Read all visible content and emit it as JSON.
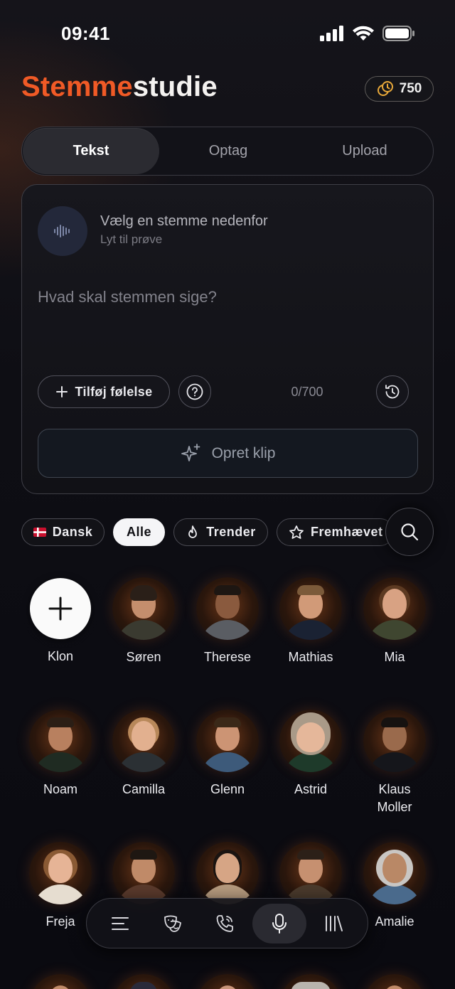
{
  "status_bar": {
    "time": "09:41",
    "icons": [
      "cellular-icon",
      "wifi-icon",
      "battery-icon"
    ]
  },
  "header": {
    "title_accent": "Stemme",
    "title_rest": "studie",
    "credits": "750",
    "credits_icon": "coins-icon",
    "accent_color": "#f05a26"
  },
  "tabs": [
    {
      "label": "Tekst",
      "active": true
    },
    {
      "label": "Optag",
      "active": false
    },
    {
      "label": "Upload",
      "active": false
    }
  ],
  "composer": {
    "voice_title": "Vælg en stemme nedenfor",
    "voice_subtitle": "Lyt til prøve",
    "placeholder": "Hvad skal stemmen sige?",
    "value": "",
    "emotion_label": "Tilføj følelse",
    "char_count": "0/700",
    "create_label": "Opret klip"
  },
  "filters": {
    "language": "Dansk",
    "chips": [
      {
        "label": "Alle",
        "active": true
      },
      {
        "label": "Trender",
        "icon": "flame-icon"
      },
      {
        "label": "Fremhævet",
        "icon": "star-icon"
      }
    ]
  },
  "voices": [
    {
      "name": "Klon",
      "type": "clone"
    },
    {
      "name": "Søren"
    },
    {
      "name": "Therese"
    },
    {
      "name": "Mathias"
    },
    {
      "name": "Mia"
    },
    {
      "name": "Noam"
    },
    {
      "name": "Camilla"
    },
    {
      "name": "Glenn"
    },
    {
      "name": "Astrid"
    },
    {
      "name": "Klaus\nMoller"
    },
    {
      "name": "Freja"
    },
    {
      "name": ""
    },
    {
      "name": ""
    },
    {
      "name": ""
    },
    {
      "name": "Amalie"
    }
  ],
  "bottom_nav": [
    {
      "icon": "menu-icon"
    },
    {
      "icon": "theater-masks-icon"
    },
    {
      "icon": "phone-icon"
    },
    {
      "icon": "microphone-icon",
      "active": true
    },
    {
      "icon": "library-icon"
    }
  ]
}
